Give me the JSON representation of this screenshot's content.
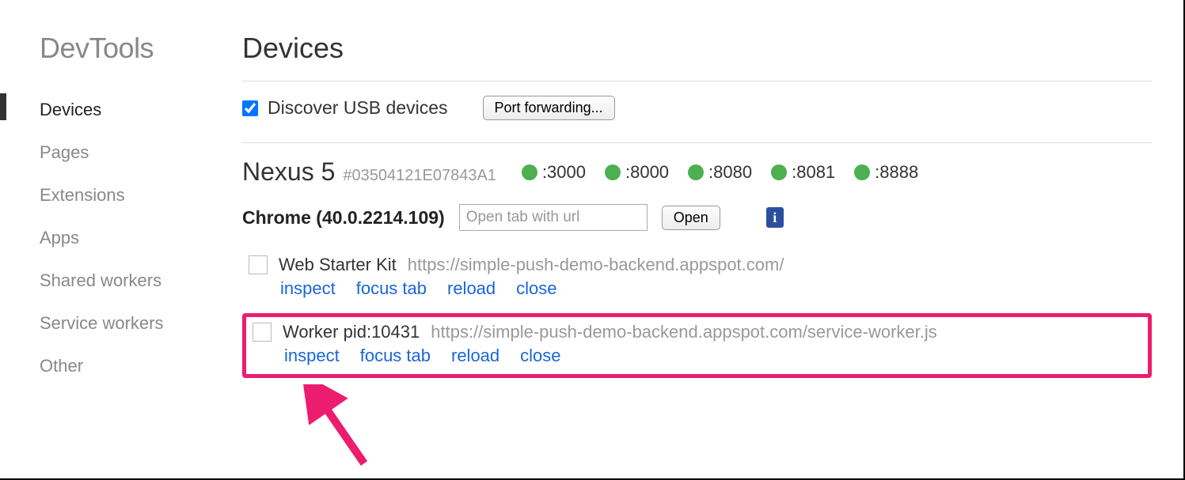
{
  "sidebar": {
    "title": "DevTools",
    "items": [
      {
        "label": "Devices",
        "active": true
      },
      {
        "label": "Pages"
      },
      {
        "label": "Extensions"
      },
      {
        "label": "Apps"
      },
      {
        "label": "Shared workers"
      },
      {
        "label": "Service workers"
      },
      {
        "label": "Other"
      }
    ]
  },
  "main": {
    "title": "Devices",
    "discover_label": "Discover USB devices",
    "discover_checked": true,
    "port_forwarding_label": "Port forwarding...",
    "device": {
      "name": "Nexus 5",
      "serial": "#03504121E07843A1",
      "ports": [
        ":3000",
        ":8000",
        ":8080",
        ":8081",
        ":8888"
      ]
    },
    "browser": {
      "label": "Chrome (40.0.2214.109)",
      "url_placeholder": "Open tab with url",
      "open_label": "Open"
    },
    "targets": [
      {
        "title": "Web Starter Kit",
        "url": "https://simple-push-demo-backend.appspot.com/",
        "highlighted": false
      },
      {
        "title": "Worker pid:10431",
        "url": "https://simple-push-demo-backend.appspot.com/service-worker.js",
        "highlighted": true
      }
    ],
    "actions": {
      "inspect": "inspect",
      "focus_tab": "focus tab",
      "reload": "reload",
      "close": "close"
    },
    "info_glyph": "i"
  },
  "colors": {
    "port_status": "#4CAF50",
    "link": "#1965d8",
    "highlight_border": "#ec1d6f"
  }
}
